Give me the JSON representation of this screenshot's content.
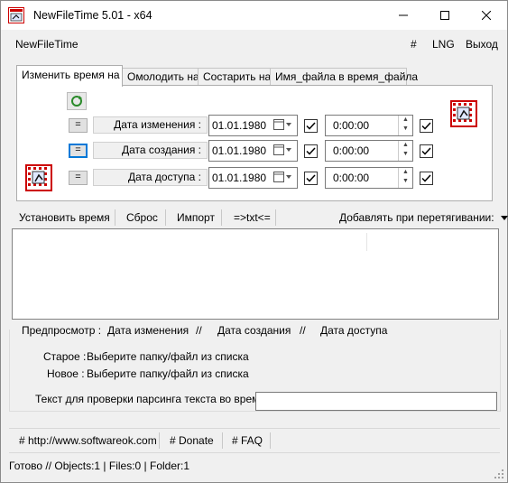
{
  "window": {
    "title": "NewFileTime 5.01 - x64"
  },
  "menu": {
    "app": "NewFileTime",
    "hash": "#",
    "lng": "LNG",
    "exit": "Выход"
  },
  "tabs": [
    "Изменить время на",
    "Омолодить на",
    "Состарить на",
    "Имя_файла в время_файла"
  ],
  "rows": [
    {
      "label": "Дата изменения :",
      "date": "01.01.1980",
      "time": "0:00:00"
    },
    {
      "label": "Дата создания :",
      "date": "01.01.1980",
      "time": "0:00:00"
    },
    {
      "label": "Дата доступа :",
      "date": "01.01.1980",
      "time": "0:00:00"
    }
  ],
  "eq_label": "=",
  "toolbar": {
    "set_time": "Установить время",
    "reset": "Сброс",
    "import": "Импорт",
    "txt": "=>txt<=",
    "drag_add": "Добавлять при перетягивании:"
  },
  "preview": {
    "preview": "Предпросмотр :",
    "modified": "Дата изменения",
    "sep1": "//",
    "created": "Дата создания",
    "sep2": "//",
    "accessed": "Дата доступа"
  },
  "old_new": {
    "old_label": "Старое :",
    "old_value": "Выберите папку/файл из списка",
    "new_label": "Новое :",
    "new_value": "Выберите папку/файл из списка"
  },
  "parse": {
    "label": "Текст для проверки парсинга текста во время",
    "value": ""
  },
  "links": {
    "site": "# http://www.softwareok.com",
    "donate": "# Donate",
    "faq": "# FAQ"
  },
  "status": {
    "text": "Готово // Objects:1 | Files:0 | Folder:1"
  },
  "colors": {
    "accent": "#0078d7",
    "window_bg": "#f0f0f0"
  }
}
